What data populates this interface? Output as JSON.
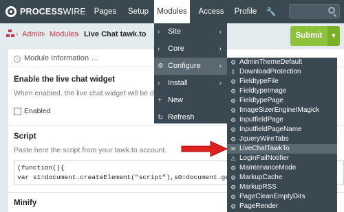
{
  "topnav": {
    "logo_bold": "PROCESS",
    "logo_light": "WIRE",
    "items": [
      "Pages",
      "Setup",
      "Modules",
      "Access",
      "Profile"
    ]
  },
  "breadcrumb": {
    "items": [
      "Admin",
      "Modules"
    ],
    "separator": "›",
    "current": "Live Chat tawk.to"
  },
  "submit": {
    "label": "Submit",
    "dropdown_icon": "chevron-down-icon"
  },
  "content": {
    "module_info": "Module Information …",
    "enable_label": "Enable the live chat widget",
    "enable_desc": "When enabled, the live chat widget will be displ",
    "enabled_checkbox_label": "Enabled",
    "script_label": "Script",
    "script_desc": "Paste here the script from your tawk.to account.",
    "script_line1": "(function(){",
    "script_line2": "var s1=document.createElement(\"script\"),s0=document.getElementsB",
    "minify_label": "Minify"
  },
  "modules_menu": {
    "items": [
      {
        "label": "Site",
        "icon": "chevron-right-icon",
        "submenu": true
      },
      {
        "label": "Core",
        "icon": "chevron-right-icon",
        "submenu": true
      },
      {
        "label": "Configure",
        "icon": "gear-icon",
        "submenu": true,
        "active": true
      },
      {
        "label": "Install",
        "icon": "chevron-right-icon",
        "submenu": true
      },
      {
        "label": "New",
        "icon": "plus-icon",
        "submenu": false
      },
      {
        "label": "Refresh",
        "icon": "refresh-icon",
        "submenu": false
      }
    ]
  },
  "configure_menu": {
    "items": [
      "AdminThemeDefault",
      "DownloadProtection",
      "FieldtypeFile",
      "FieldtypeImage",
      "FieldtypePage",
      "ImageSizerEngineIMagick",
      "InputfieldPage",
      "InputfieldPageName",
      "JqueryWireTabs",
      "LiveChatTawkTo",
      "LoginFailNotifier",
      "MaintenanceMode",
      "MarkupCache",
      "MarkupRSS",
      "PageCleanEmptyDirs",
      "PageRender"
    ],
    "highlighted": "LiveChatTawkTo"
  },
  "colors": {
    "topbar": "#3a4852",
    "accent_red": "#c0394a",
    "submit_green": "#8dc23a",
    "arrow_red": "#e02020"
  }
}
